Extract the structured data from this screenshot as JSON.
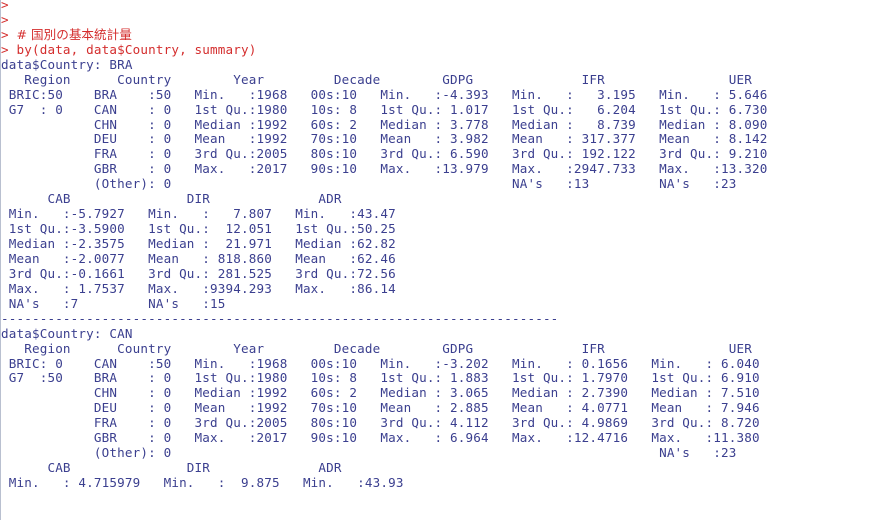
{
  "console": {
    "prompt_color": "#d42e2e",
    "output_color": "#3b3f8f",
    "background_color": "#ffffff",
    "border_color": "#b9c0d0",
    "lines": [
      {
        "type": "prompt",
        "text": ">"
      },
      {
        "type": "prompt",
        "text": ">"
      },
      {
        "type": "command",
        "text": "> # 国別の基本統計量"
      },
      {
        "type": "command",
        "text": "> by(data, data$Country, summary)"
      },
      {
        "type": "output",
        "text": "data$Country: BRA"
      },
      {
        "type": "output",
        "text": "   Region      Country        Year         Decade        GDPG              IFR                UER        "
      },
      {
        "type": "output",
        "text": " BRIC:50    BRA    :50   Min.   :1968   00s:10   Min.   :-4.393   Min.   :   3.195   Min.   : 5.646  "
      },
      {
        "type": "output",
        "text": " G7  : 0    CAN    : 0   1st Qu.:1980   10s: 8   1st Qu.: 1.017   1st Qu.:   6.204   1st Qu.: 6.730  "
      },
      {
        "type": "output",
        "text": "            CHN    : 0   Median :1992   60s: 2   Median : 3.778   Median :   8.739   Median : 8.090  "
      },
      {
        "type": "output",
        "text": "            DEU    : 0   Mean   :1992   70s:10   Mean   : 3.982   Mean   : 317.377   Mean   : 8.142  "
      },
      {
        "type": "output",
        "text": "            FRA    : 0   3rd Qu.:2005   80s:10   3rd Qu.: 6.590   3rd Qu.: 192.122   3rd Qu.: 9.210  "
      },
      {
        "type": "output",
        "text": "            GBR    : 0   Max.   :2017   90s:10   Max.   :13.979   Max.   :2947.733   Max.   :13.320  "
      },
      {
        "type": "output",
        "text": "            (Other): 0                                            NA's   :13         NA's   :23      "
      },
      {
        "type": "output",
        "text": "      CAB               DIR              ADR       "
      },
      {
        "type": "output",
        "text": " Min.   :-5.7927   Min.   :   7.807   Min.   :43.47  "
      },
      {
        "type": "output",
        "text": " 1st Qu.:-3.5900   1st Qu.:  12.051   1st Qu.:50.25  "
      },
      {
        "type": "output",
        "text": " Median :-2.3575   Median :  21.971   Median :62.82  "
      },
      {
        "type": "output",
        "text": " Mean   :-2.0077   Mean   : 818.860   Mean   :62.46  "
      },
      {
        "type": "output",
        "text": " 3rd Qu.:-0.1661   3rd Qu.: 281.525   3rd Qu.:72.56  "
      },
      {
        "type": "output",
        "text": " Max.   : 1.7537   Max.   :9394.293   Max.   :86.14  "
      },
      {
        "type": "output",
        "text": " NA's   :7         NA's   :15                       "
      },
      {
        "type": "output",
        "text": "------------------------------------------------------------------------ "
      },
      {
        "type": "output",
        "text": "data$Country: CAN"
      },
      {
        "type": "output",
        "text": "   Region      Country        Year         Decade        GDPG              IFR                UER        "
      },
      {
        "type": "output",
        "text": " BRIC: 0    CAN    :50   Min.   :1968   00s:10   Min.   :-3.202   Min.   : 0.1656   Min.   : 6.040  "
      },
      {
        "type": "output",
        "text": " G7  :50    BRA    : 0   1st Qu.:1980   10s: 8   1st Qu.: 1.883   1st Qu.: 1.7970   1st Qu.: 6.910  "
      },
      {
        "type": "output",
        "text": "            CHN    : 0   Median :1992   60s: 2   Median : 3.065   Median : 2.7390   Median : 7.510  "
      },
      {
        "type": "output",
        "text": "            DEU    : 0   Mean   :1992   70s:10   Mean   : 2.885   Mean   : 4.0771   Mean   : 7.946  "
      },
      {
        "type": "output",
        "text": "            FRA    : 0   3rd Qu.:2005   80s:10   3rd Qu.: 4.112   3rd Qu.: 4.9869   3rd Qu.: 8.720  "
      },
      {
        "type": "output",
        "text": "            GBR    : 0   Max.   :2017   90s:10   Max.   : 6.964   Max.   :12.4716   Max.   :11.380  "
      },
      {
        "type": "output",
        "text": "            (Other): 0                                                               NA's   :23      "
      },
      {
        "type": "output",
        "text": "      CAB               DIR              ADR       "
      },
      {
        "type": "output",
        "text": " Min.   : 4.715979   Min.   :  9.875   Min.   :43.93  "
      }
    ]
  }
}
